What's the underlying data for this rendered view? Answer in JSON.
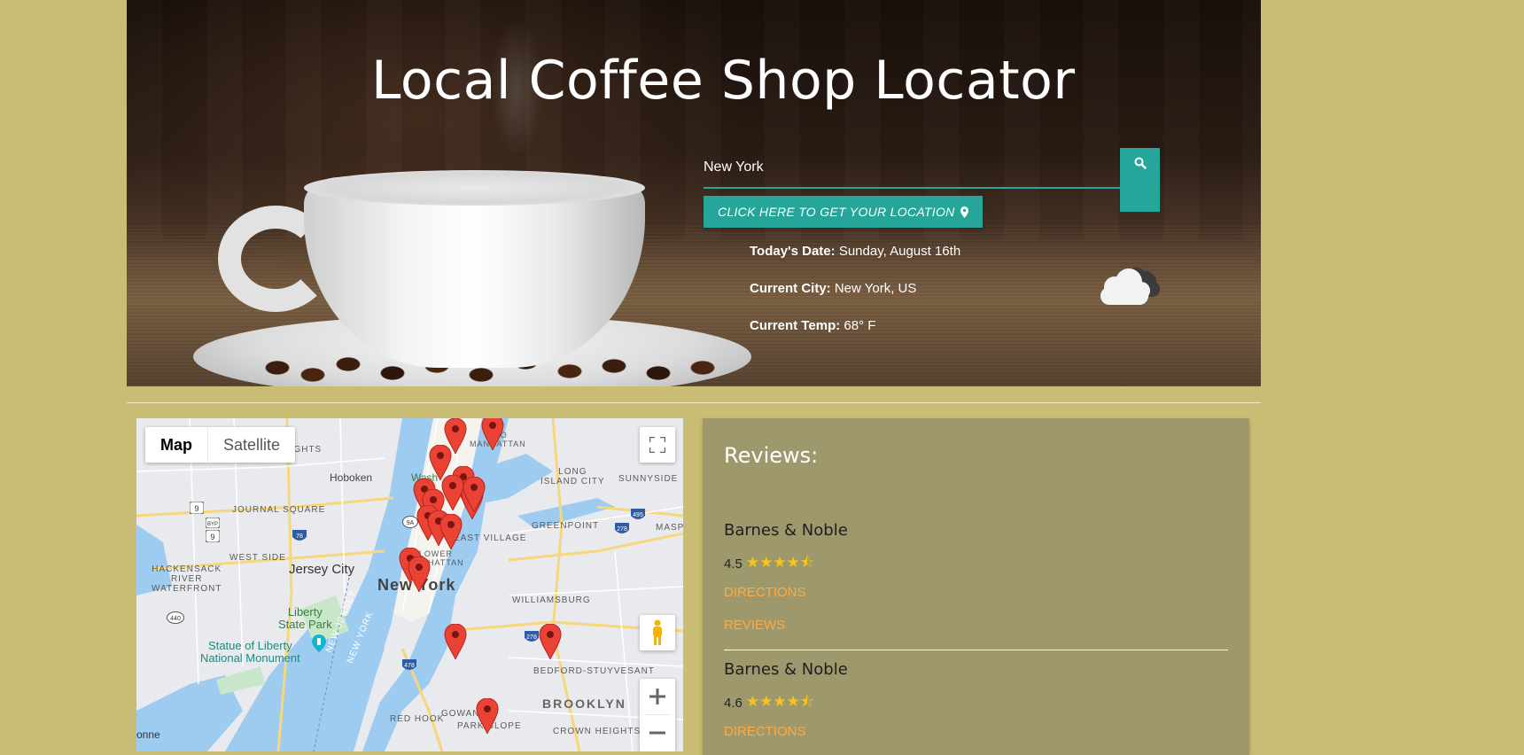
{
  "header": {
    "title": "Local Coffee Shop Locator"
  },
  "search": {
    "value": "New York",
    "button_icon": "search-icon"
  },
  "location_button": {
    "label": "CLICK HERE TO GET YOUR LOCATION",
    "icon": "map-marker-icon"
  },
  "info": {
    "date_label": "Today's Date:",
    "date_value": "Sunday, August 16th",
    "city_label": "Current City:",
    "city_value": "New York, US",
    "temp_label": "Current Temp:",
    "temp_value": "68° F",
    "weather_icon": "cloud-icon"
  },
  "map": {
    "type_options": [
      "Map",
      "Satellite"
    ],
    "selected_type": "Map",
    "controls": [
      "fullscreen-icon",
      "pegman-icon",
      "zoom-in-icon",
      "zoom-out-icon"
    ],
    "labels": {
      "hoboken": "Hoboken",
      "heights": "EIGHTS",
      "journal_square": "JOURNAL SQUARE",
      "west_side": "WEST SIDE",
      "jersey_city": "Jersey City",
      "hackensack": "HACKENSACK\nRIVER\nWATERFRONT",
      "liberty_state_park": "Liberty\nState Park",
      "statue_of_liberty": "Statue of Liberty\nNational Monument",
      "new_york": "New York",
      "long_island_city": "LONG\nISLAND CITY",
      "sunnyside": "SUNNYSIDE",
      "greenpoint": "GREENPOINT",
      "maspeth": "MASPE",
      "williamsburg": "WILLIAMSBURG",
      "bedford": "BEDFORD-STUYVESANT",
      "brooklyn": "BROOKLYN",
      "red_hook": "RED HOOK",
      "gowanus": "GOWAN",
      "park_slope": "PARK SLOPE",
      "crown_heights": "CROWN HEIGHTS",
      "east_village": "EAST VILLAGE",
      "lower_manhattan": "LOWER\nMANHATTAN",
      "midtown": "DTO\nMANHATTAN",
      "washington": "Wash",
      "new_jersey": "NEW JERSEY",
      "new_york_state": "NEW YORK",
      "onne": "onne",
      "shields": [
        "9",
        "BYP\n1",
        "9",
        "78",
        "9A",
        "440",
        "278",
        "495",
        "278",
        "478"
      ]
    }
  },
  "reviews": {
    "title": "Reviews:",
    "items": [
      {
        "name": "Barnes & Noble",
        "rating": "4.5",
        "stars": 4.5,
        "directions": "DIRECTIONS",
        "reviews_link": "REVIEWS"
      },
      {
        "name": "Barnes & Noble",
        "rating": "4.6",
        "stars": 4.5,
        "directions": "DIRECTIONS",
        "reviews_link": "REVIEWS"
      }
    ]
  },
  "colors": {
    "page_background": "#c9bc74",
    "accent": "#26a69a",
    "reviews_panel": "#9e986d",
    "link": "#ffab40",
    "star": "#f5c518",
    "pin": "#ea4335"
  }
}
